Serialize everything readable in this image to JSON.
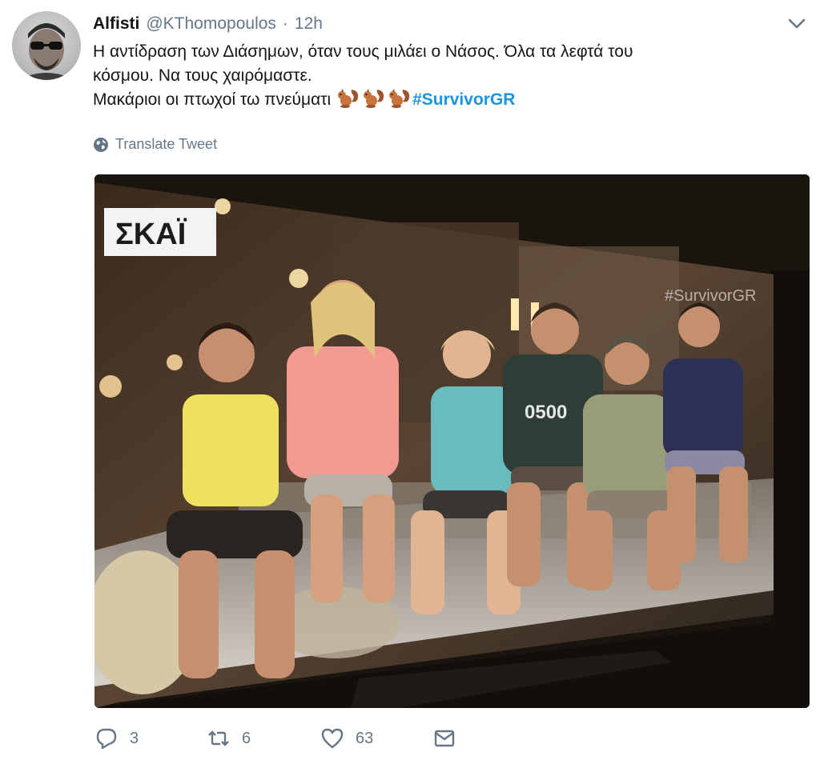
{
  "tweet": {
    "display_name": "Alfisti",
    "handle": "@KThomopoulos",
    "separator": "·",
    "time": "12h",
    "lines": [
      "Η αντίδραση των Διάσημων, όταν τους μιλάει ο Νάσος. Όλα τα λεφτά του",
      "κόσμου. Να τους χαιρόμαστε.",
      "Μακάριοι οι πτωχοί τω πνεύματι"
    ],
    "emoji": "squirrel",
    "hashtag": "#SurvivorGR",
    "translate_label": "Translate Tweet"
  },
  "media": {
    "channel_logo": "ΣΚΑΪ",
    "screen_hashtag": "#SurvivorGR",
    "shirt_number": "0500"
  },
  "actions": {
    "reply_count": "3",
    "retweet_count": "6",
    "like_count": "63"
  },
  "colors": {
    "link": "#1b95e0",
    "secondary_text": "#657786",
    "text": "#14171a"
  }
}
